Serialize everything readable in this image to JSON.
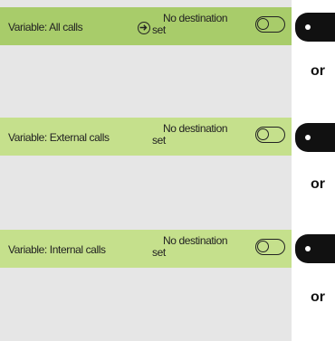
{
  "rows": [
    {
      "label": "Variable: All calls",
      "dest_line1": "No destination",
      "dest_line2": "set",
      "has_arrow_icon": true
    },
    {
      "label": "Variable: External calls",
      "dest_line1": "No destination",
      "dest_line2": "set",
      "has_arrow_icon": false
    },
    {
      "label": "Variable: Internal calls",
      "dest_line1": "No destination",
      "dest_line2": "set",
      "has_arrow_icon": false
    }
  ],
  "separator_text": "or",
  "icons": {
    "destination": "arrow-right-circle-icon",
    "toggle": "toggle-off-icon",
    "key": "select-key-icon"
  },
  "colors": {
    "row_active": "#a8cc6a",
    "row_inactive": "#c5e08c",
    "panel_bg": "#e6e6e6",
    "key": "#111111"
  }
}
